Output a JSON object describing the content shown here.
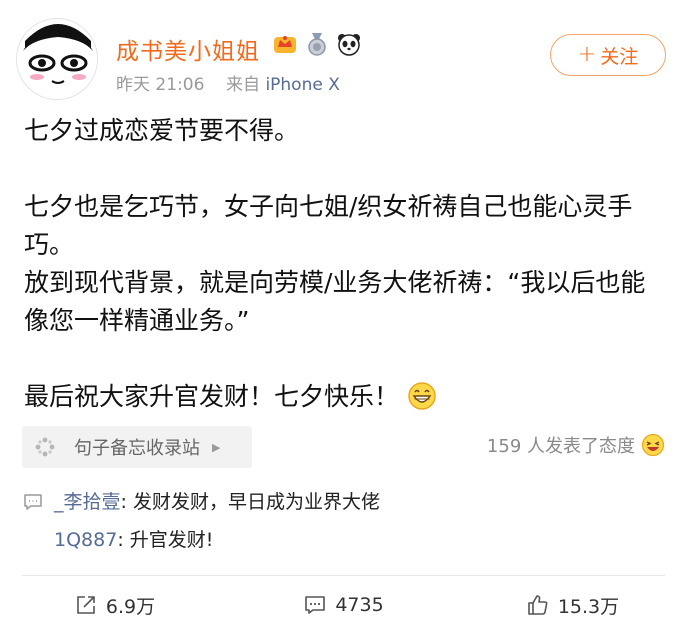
{
  "post": {
    "author": {
      "name": "成书美小姐姐",
      "badges": [
        "vip-crown-icon",
        "medal-icon",
        "panda-icon"
      ]
    },
    "time": "昨天 21:06",
    "source_prefix": "来自",
    "device": "iPhone X",
    "follow_label": "关注",
    "paragraphs": [
      "七夕过成恋爱节要不得。",
      "七夕也是乞巧节，女子向七姐/织女祈祷自己也能心灵手巧。",
      "放到现代背景，就是向劳模/业务大佬祈祷：“我以后也能像您一样精通业务。”",
      "最后祝大家升官发财！七夕快乐！"
    ],
    "source_tag": "句子备忘收录站",
    "attitude_text": "159 人发表了态度",
    "comments": [
      {
        "user": "_李拾壹",
        "text": ": 发财发财，早日成为业界大佬"
      },
      {
        "user": "1Q887",
        "text": ": 升官发财!"
      }
    ],
    "actions": {
      "repost": "6.9万",
      "comment": "4735",
      "like": "15.3万"
    }
  },
  "colors": {
    "accent": "#f26a1b",
    "link": "#566b95",
    "muted": "#9a9a9a"
  }
}
